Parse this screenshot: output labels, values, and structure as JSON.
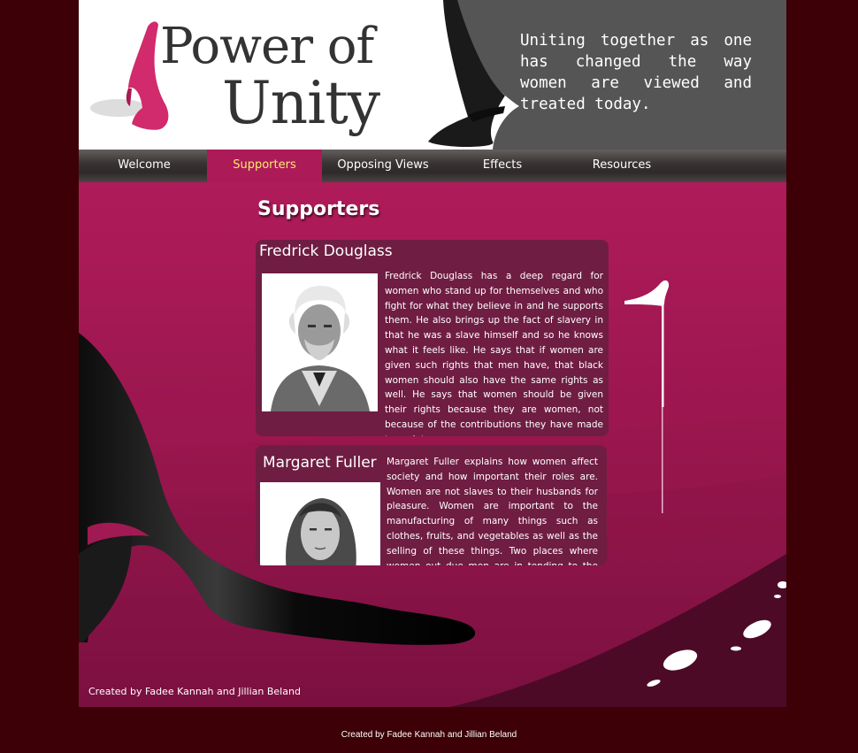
{
  "header": {
    "logo_line1": "Power of",
    "logo_line2": "Unity",
    "tagline": "Uniting together as one has changed the way women are viewed and treated today."
  },
  "nav": {
    "items": [
      {
        "label": "Welcome",
        "active": false
      },
      {
        "label": "Supporters",
        "active": true
      },
      {
        "label": "Opposing Views",
        "active": false
      },
      {
        "label": "Effects",
        "active": false
      },
      {
        "label": "Resources",
        "active": false
      }
    ]
  },
  "main": {
    "title": "Supporters",
    "supporters": [
      {
        "name": "Fredrick Douglass",
        "text": "Fredrick Douglass has a deep regard for women who stand up for themselves and who fight for what they believe in and he supports them. He also brings up the fact of slavery in that he was a slave himself and so he knows what it feels like. He says that if women are given such rights that men have, that black women should also have the same rights as well. He says that women should be given their rights because they are women, not because of the contributions they have made to society."
      },
      {
        "name": "Margaret Fuller",
        "text": "Margaret Fuller explains how women affect society and how important their roles are. Women are not slaves to their husbands for pleasure. Women are important to the manufacturing of many things such as clothes, fruits, and vegetables as well as the selling of these things. Two places where women out due men are in tending to the sick and"
      }
    ]
  },
  "footer": {
    "inner_credit": "Created by Fadee Kannah and Jillian Beland",
    "outer_credit": "Created by Fadee Kannah and Jillian Beland"
  },
  "colors": {
    "page_background": "#3c0006",
    "content_background": "#ad1a58",
    "card_background": "#6f1d43",
    "nav_active_text": "#f6ec6c",
    "header_dark": "#555555"
  }
}
